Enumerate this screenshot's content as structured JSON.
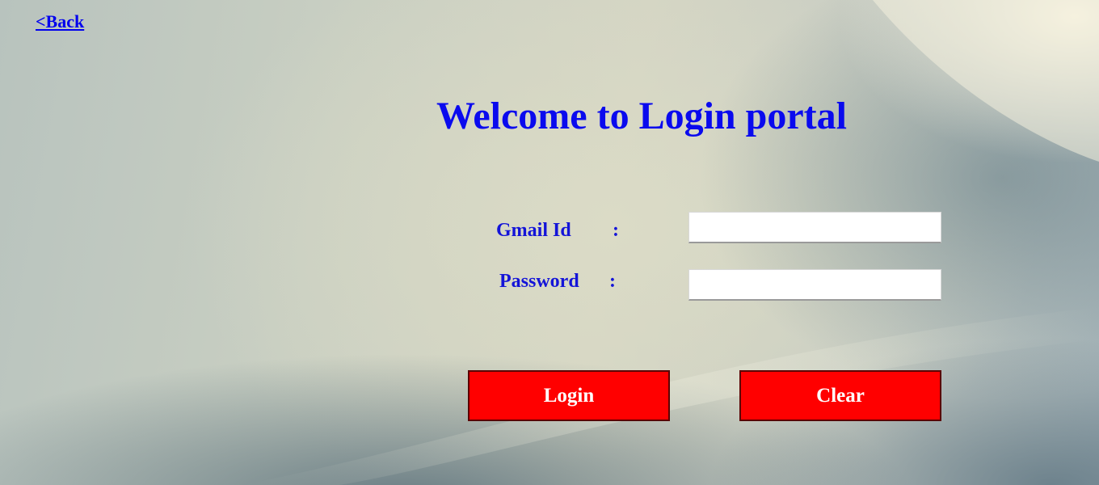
{
  "nav": {
    "back_label": "<Back"
  },
  "header": {
    "title": "Welcome to Login portal"
  },
  "form": {
    "email_label": "Gmail Id",
    "password_label": "Password",
    "separator": ":",
    "email_value": "",
    "password_value": "",
    "login_label": "Login",
    "clear_label": "Clear"
  },
  "colors": {
    "accent": "#0000ee",
    "label": "#1414d8",
    "button": "#ff0000",
    "button_text": "#ffffff"
  }
}
